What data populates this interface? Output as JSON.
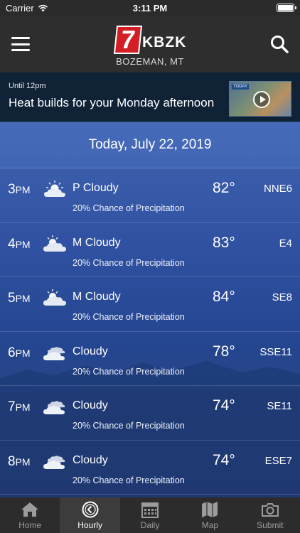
{
  "status_bar": {
    "carrier": "Carrier",
    "time": "3:11 PM",
    "wifi_icon": "wifi-icon",
    "battery_icon": "battery-icon"
  },
  "header": {
    "logo_numeral": "7",
    "logo_text": "KBZK",
    "location": "BOZEMAN, MT",
    "menu_icon": "hamburger-menu-icon",
    "search_icon": "search-icon"
  },
  "alert": {
    "until": "Until 12pm",
    "headline": "Heat builds for your Monday afternoon",
    "thumbnail_tag": "TODAY",
    "thumbnail_icon": "play-icon"
  },
  "forecast": {
    "date": "Today, July 22, 2019",
    "rows": [
      {
        "hour": "3",
        "period": "PM",
        "icon": "partly-cloudy-icon",
        "condition": "P Cloudy",
        "temp": "82°",
        "wind": "NNE6",
        "precip": "20% Chance of Precipitation"
      },
      {
        "hour": "4",
        "period": "PM",
        "icon": "mostly-cloudy-icon",
        "condition": "M Cloudy",
        "temp": "83°",
        "wind": "E4",
        "precip": "20% Chance of Precipitation"
      },
      {
        "hour": "5",
        "period": "PM",
        "icon": "mostly-cloudy-icon",
        "condition": "M Cloudy",
        "temp": "84°",
        "wind": "SE8",
        "precip": "20% Chance of Precipitation"
      },
      {
        "hour": "6",
        "period": "PM",
        "icon": "cloudy-icon",
        "condition": "Cloudy",
        "temp": "78°",
        "wind": "SSE11",
        "precip": "20% Chance of Precipitation"
      },
      {
        "hour": "7",
        "period": "PM",
        "icon": "cloudy-icon",
        "condition": "Cloudy",
        "temp": "74°",
        "wind": "SE11",
        "precip": "20% Chance of Precipitation"
      },
      {
        "hour": "8",
        "period": "PM",
        "icon": "cloudy-icon",
        "condition": "Cloudy",
        "temp": "74°",
        "wind": "ESE7",
        "precip": "20% Chance of Precipitation"
      }
    ]
  },
  "tabs": [
    {
      "label": "Home",
      "icon": "home-icon",
      "active": false
    },
    {
      "label": "Hourly",
      "icon": "clock-icon",
      "active": true
    },
    {
      "label": "Daily",
      "icon": "calendar-icon",
      "active": false
    },
    {
      "label": "Map",
      "icon": "map-icon",
      "active": false
    },
    {
      "label": "Submit",
      "icon": "camera-icon",
      "active": false
    }
  ],
  "colors": {
    "brand_red": "#d21f26",
    "header_bg": "#2e2e2e",
    "banner_bg": "#0f2236",
    "tab_active": "#ffffff",
    "tab_inactive": "#9c9c9c"
  }
}
